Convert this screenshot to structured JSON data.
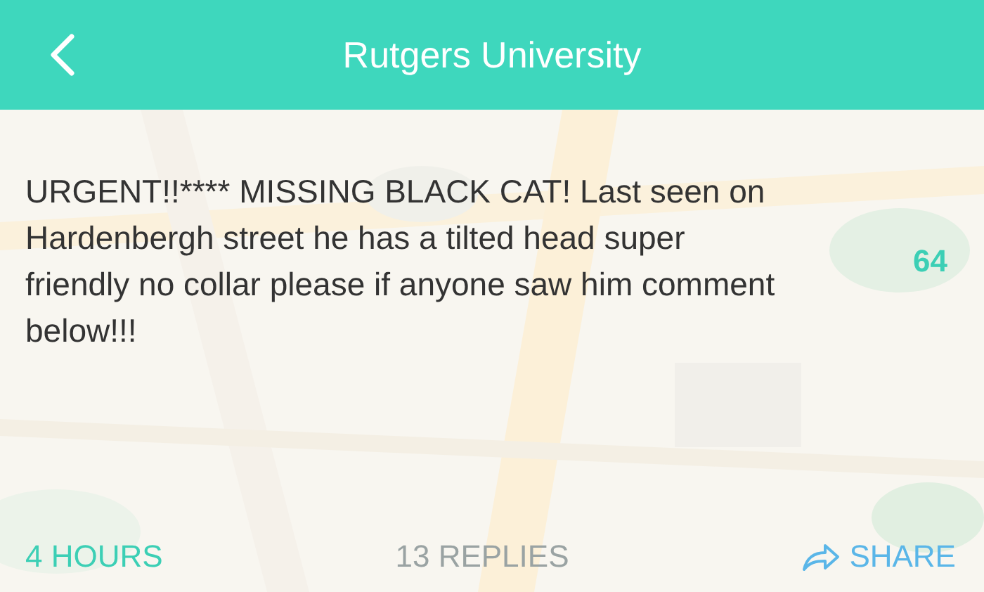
{
  "header": {
    "title": "Rutgers University"
  },
  "post": {
    "text": "URGENT!!**** MISSING BLACK CAT! Last seen on Hardenbergh street he has a tilted head super friendly no collar please if anyone saw him comment below!!!",
    "votes": "64"
  },
  "footer": {
    "time": "4 HOURS",
    "replies": "13 REPLIES",
    "share": "SHARE"
  }
}
